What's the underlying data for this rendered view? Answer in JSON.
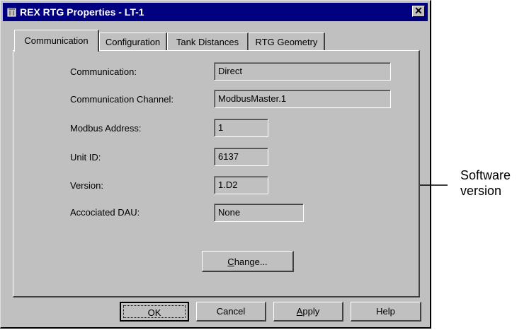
{
  "window": {
    "title": "REX RTG Properties - LT-1",
    "close_label": "✕"
  },
  "tabs": [
    {
      "label": "Communication",
      "active": true
    },
    {
      "label": "Configuration",
      "active": false
    },
    {
      "label": "Tank Distances",
      "active": false
    },
    {
      "label": "RTG Geometry",
      "active": false
    }
  ],
  "fields": [
    {
      "label": "Communication:",
      "value": "Direct"
    },
    {
      "label": "Communication Channel:",
      "value": "ModbusMaster.1"
    },
    {
      "label": "Modbus Address:",
      "value": "1"
    },
    {
      "label": "Unit ID:",
      "value": "6137"
    },
    {
      "label": "Version:",
      "value": "1.D2"
    },
    {
      "label": "Accociated DAU:",
      "value": "None"
    }
  ],
  "change_button": {
    "prefix": "",
    "mnemonic": "C",
    "rest": "hange..."
  },
  "footer": {
    "ok": "OK",
    "cancel": "Cancel",
    "apply_mnemonic": "A",
    "apply_rest": "pply",
    "help": "Help"
  },
  "annotation": {
    "line1": "Software",
    "line2": "version",
    "highlight_color": "#e0202a"
  },
  "colors": {
    "titlebar": "#000080",
    "face": "#c0c0c0"
  }
}
